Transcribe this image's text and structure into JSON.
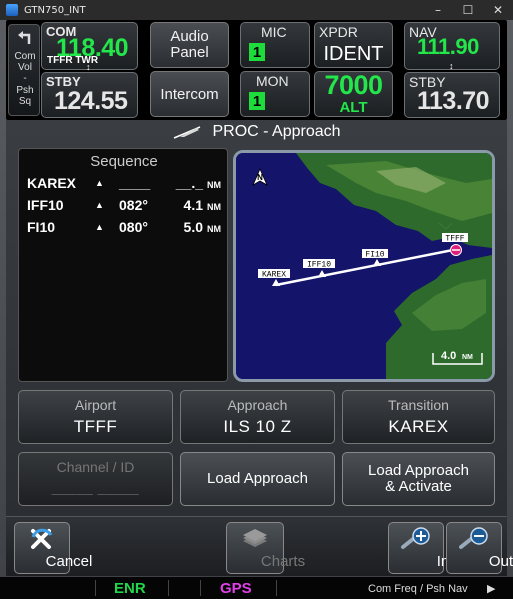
{
  "window": {
    "title": "GTN750_INT",
    "minimize": "–",
    "maximize": "☐",
    "close": "✕"
  },
  "com": {
    "label": "COM",
    "active_freq": "118.40",
    "active_station": "TFFR TWR",
    "stby_label": "STBY",
    "stby_freq": "124.55",
    "side_lines": [
      "Com",
      "Vol",
      "-",
      "Psh",
      "Sq"
    ]
  },
  "audio_panel": {
    "label_line1": "Audio",
    "label_line2": "Panel"
  },
  "intercom": {
    "label": "Intercom"
  },
  "mic": {
    "label": "MIC",
    "value": "1"
  },
  "mon": {
    "label": "MON",
    "value": "1"
  },
  "xpdr": {
    "label": "XPDR",
    "mode": "IDENT",
    "code": "7000",
    "alt": "ALT"
  },
  "nav": {
    "label": "NAV",
    "active_freq": "111.90",
    "stby_label": "STBY",
    "stby_freq": "113.70"
  },
  "page": {
    "title": "PROC - Approach"
  },
  "sequence": {
    "title": "Sequence",
    "rows": [
      {
        "wp": "KAREX",
        "crs": "____",
        "dist": "__._",
        "unit": "NM"
      },
      {
        "wp": "IFF10",
        "crs": "082°",
        "dist": "4.1",
        "unit": "NM"
      },
      {
        "wp": "FI10",
        "crs": "080°",
        "dist": "5.0",
        "unit": "NM"
      }
    ]
  },
  "map": {
    "north": "N",
    "waypoints": [
      "KAREX",
      "IFF10",
      "FI10",
      "TFFF"
    ],
    "scale": "4.0",
    "scale_unit": "NM",
    "colors": {
      "water": "#13146a",
      "land": "#2f6b2a",
      "route": "#ffffff",
      "airport": "#e0207a"
    }
  },
  "selectors": {
    "airport": {
      "caption": "Airport",
      "value": "TFFF"
    },
    "approach": {
      "caption": "Approach",
      "value": "ILS 10 Z"
    },
    "transition": {
      "caption": "Transition",
      "value": "KAREX"
    },
    "channel": {
      "caption": "Channel / ID",
      "value": "_____ _____"
    }
  },
  "actions": {
    "load_approach": "Load Approach",
    "load_activate_1": "Load Approach",
    "load_activate_2": "& Activate"
  },
  "bottom": {
    "cancel": "Cancel",
    "charts": "Charts",
    "in": "In",
    "out": "Out"
  },
  "status": {
    "enr": "ENR",
    "gps": "GPS",
    "hint": "Com Freq / Psh Nav",
    "colors": {
      "enr": "#22d64a",
      "gps": "#e040e8"
    }
  }
}
